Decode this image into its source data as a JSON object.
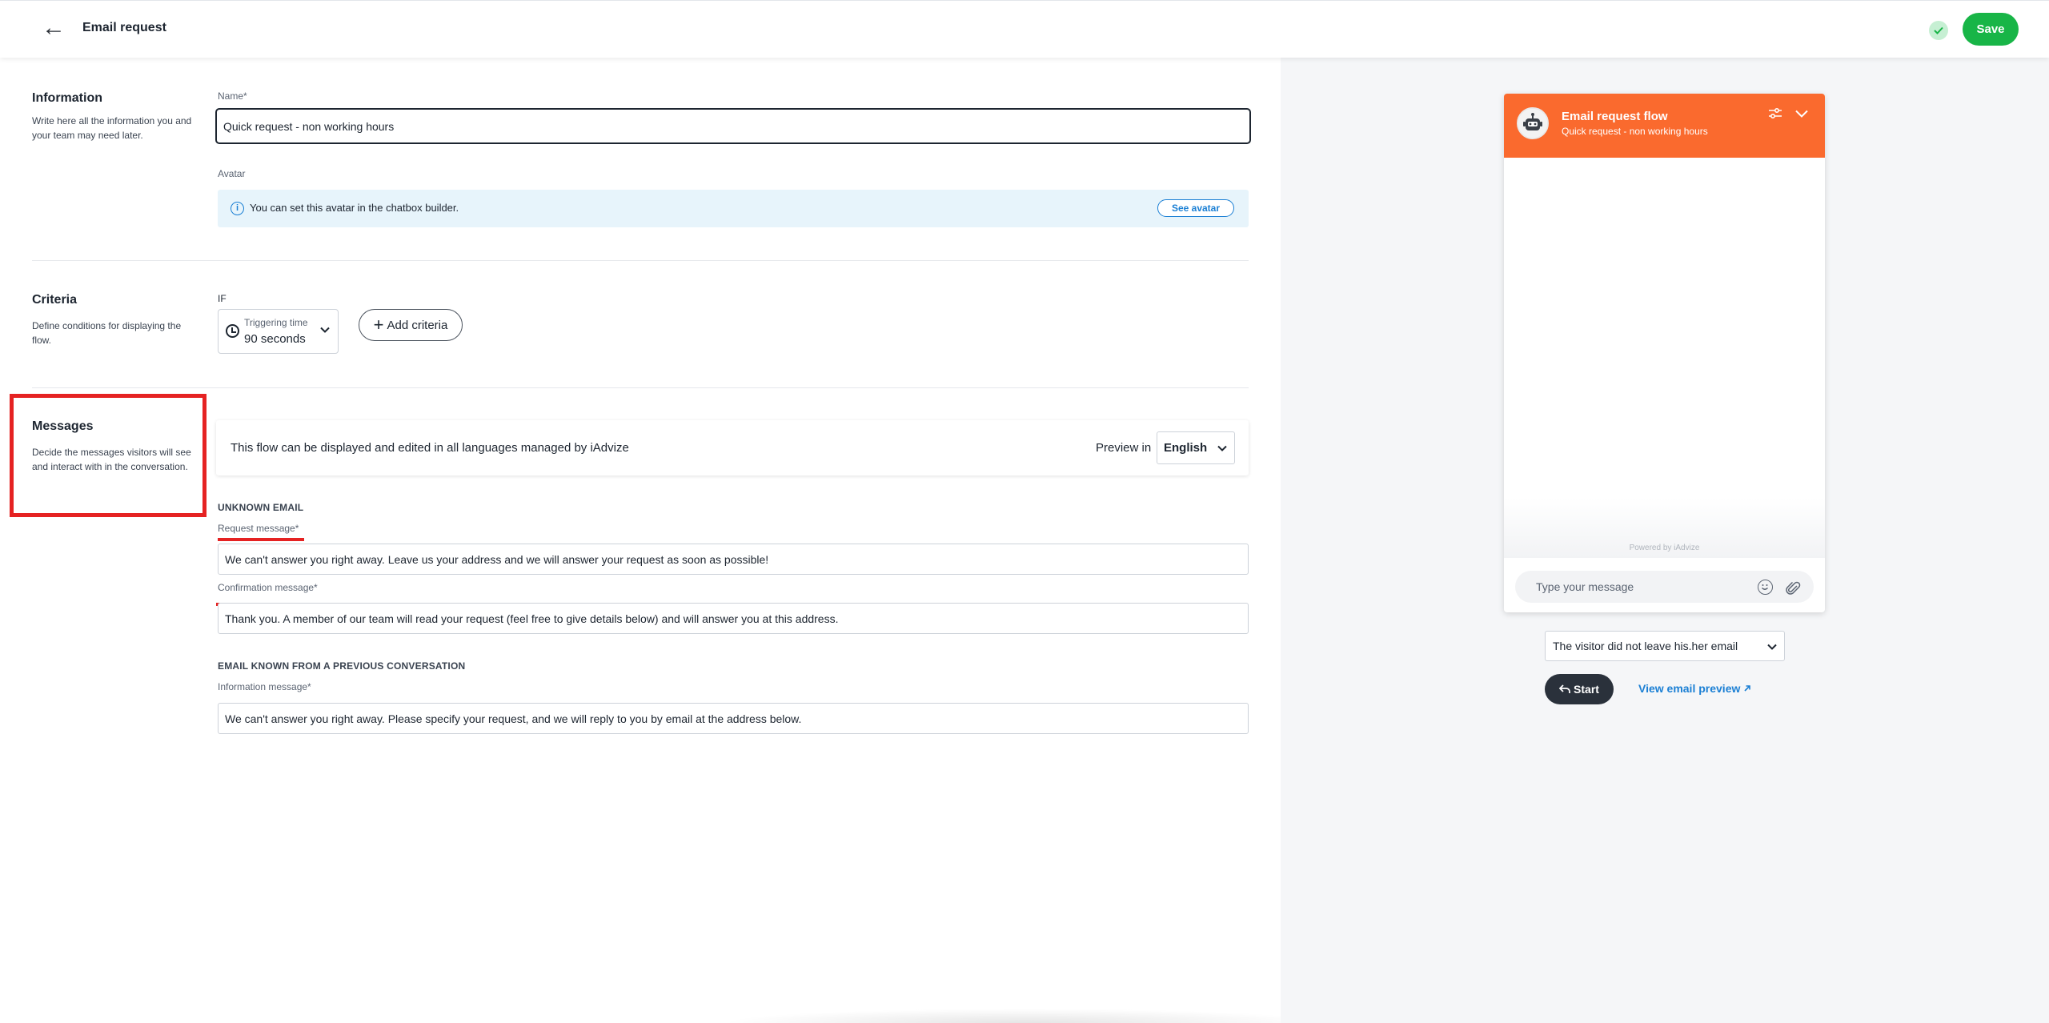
{
  "header": {
    "back_icon": "arrow-left-icon",
    "title": "Email request",
    "status_icon": "check-circle-icon",
    "save_label": "Save"
  },
  "information": {
    "title": "Information",
    "description": "Write here all the information you and your team may need later.",
    "name_label": "Name*",
    "name_value": "Quick request - non working hours",
    "avatar_label": "Avatar",
    "avatar_info": "You can set this avatar in the chatbox builder.",
    "see_avatar_label": "See avatar"
  },
  "criteria": {
    "title": "Criteria",
    "description": "Define conditions for displaying the flow.",
    "if_label": "IF",
    "trigger_label": "Triggering time",
    "trigger_value": "90 seconds",
    "add_criteria_label": "Add criteria"
  },
  "messages": {
    "title": "Messages",
    "description": "Decide the messages visitors will see and interact with in the conversation.",
    "languages_text": "This flow can be displayed and edited in all languages managed by iAdvize",
    "preview_in_label": "Preview in",
    "preview_language": "English",
    "unknown_email_heading": "UNKNOWN EMAIL",
    "request_label": "Request message*",
    "request_value": "We can't answer you right away. Leave us your address and we will answer your request as soon as possible!",
    "confirmation_label": "Confirmation message*",
    "confirmation_value": "Thank you. A member of our team will read your request (feel free to give details below) and will answer you at this address.",
    "known_email_heading": "EMAIL KNOWN FROM A PREVIOUS CONVERSATION",
    "information_label": "Information message*",
    "information_value": "We can't answer you right away. Please specify your request, and we will reply to you by email at the address below."
  },
  "preview": {
    "chat_title": "Email request flow",
    "chat_subtitle": "Quick request - non working hours",
    "powered_by": "Powered by iAdvize",
    "input_placeholder": "Type your message",
    "scenario_value": "The visitor did not leave his.her email",
    "start_label": "Start",
    "email_preview_label": "View email preview",
    "accent_color": "#fa6a2e"
  }
}
